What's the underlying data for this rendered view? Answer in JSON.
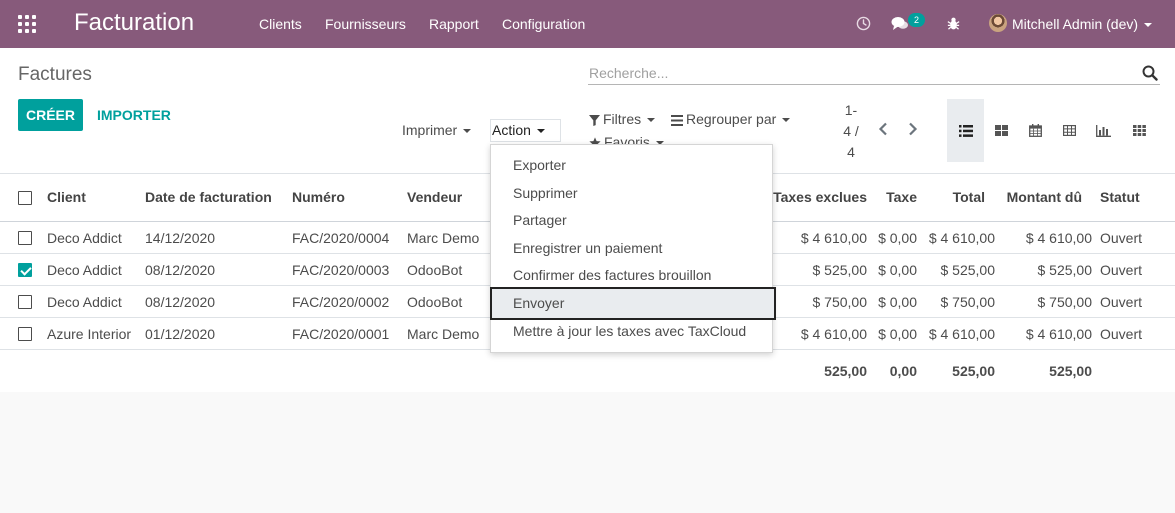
{
  "navbar": {
    "brand": "Facturation",
    "menu": [
      "Clients",
      "Fournisseurs",
      "Rapport",
      "Configuration"
    ],
    "chat_badge": "2",
    "user": "Mitchell Admin (dev)",
    "bg_color": "#875a7b"
  },
  "control_panel": {
    "breadcrumb": "Factures",
    "search_placeholder": "Recherche...",
    "create_label": "CRÉER",
    "import_label": "IMPORTER",
    "print_label": "Imprimer",
    "action_label": "Action",
    "filters_label": "Filtres",
    "group_by_label": "Regrouper par",
    "favorites_label": "Favoris",
    "pager": {
      "line1": "1-",
      "line2": "4 /",
      "line3": "4"
    },
    "views": [
      "list-view-icon",
      "kanban-view-icon",
      "calendar-view-icon",
      "pivot-view-icon",
      "graph-view-icon",
      "activity-view-icon"
    ],
    "accent": "#00a09d"
  },
  "action_menu": {
    "items": [
      "Exporter",
      "Supprimer",
      "Partager",
      "Enregistrer un paiement",
      "Confirmer des factures brouillon",
      "Envoyer",
      "Mettre à jour les taxes avec TaxCloud"
    ],
    "highlighted_index": 5
  },
  "table": {
    "columns": [
      "Client",
      "Date de facturation",
      "Numéro",
      "Vendeur",
      "Taxes exclues",
      "Taxe",
      "Total",
      "Montant dû",
      "Statut"
    ],
    "rows": [
      {
        "checked": false,
        "client": "Deco Addict",
        "date": "14/12/2020",
        "number": "FAC/2020/0004",
        "salesperson": "Marc Demo",
        "untaxed": "$ 4 610,00",
        "tax": "$ 0,00",
        "total": "$ 4 610,00",
        "due": "$ 4 610,00",
        "status": "Ouvert"
      },
      {
        "checked": true,
        "client": "Deco Addict",
        "date": "08/12/2020",
        "number": "FAC/2020/0003",
        "salesperson": "OdooBot",
        "untaxed": "$ 525,00",
        "tax": "$ 0,00",
        "total": "$ 525,00",
        "due": "$ 525,00",
        "status": "Ouvert"
      },
      {
        "checked": false,
        "client": "Deco Addict",
        "date": "08/12/2020",
        "number": "FAC/2020/0002",
        "salesperson": "OdooBot",
        "untaxed": "$ 750,00",
        "tax": "$ 0,00",
        "total": "$ 750,00",
        "due": "$ 750,00",
        "status": "Ouvert"
      },
      {
        "checked": false,
        "client": "Azure Interior",
        "date": "01/12/2020",
        "number": "FAC/2020/0001",
        "salesperson": "Marc Demo",
        "untaxed": "$ 4 610,00",
        "tax": "$ 0,00",
        "total": "$ 4 610,00",
        "due": "$ 4 610,00",
        "status": "Ouvert"
      }
    ],
    "totals": {
      "untaxed": "525,00",
      "tax": "0,00",
      "total": "525,00",
      "due": "525,00"
    }
  }
}
